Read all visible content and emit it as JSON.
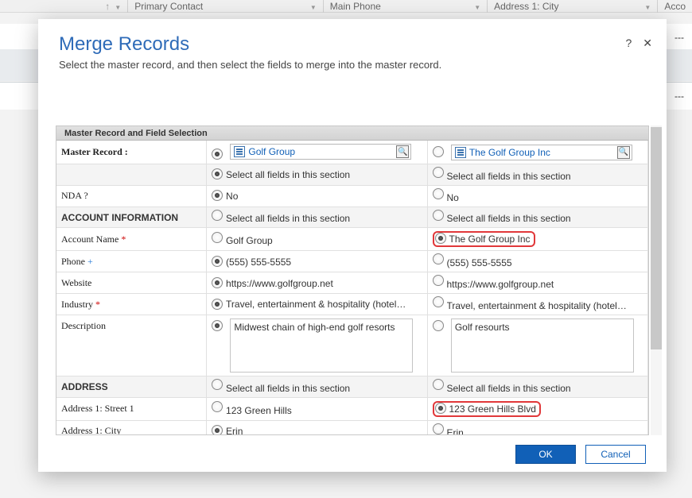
{
  "bg": {
    "cols": [
      "Primary Contact",
      "Main Phone",
      "Address 1: City",
      "Acco"
    ],
    "ellips": "---"
  },
  "dialog": {
    "title": "Merge Records",
    "subtitle": "Select the master record, and then select the fields to merge into the master record.",
    "help": "?",
    "close": "✕",
    "section_bar": "Master Record and Field Selection",
    "master_label": "Master Record :",
    "record1": "Golf Group",
    "record2": "The Golf Group Inc",
    "select_all": "Select all fields in this section",
    "rows": {
      "nda_label": "NDA ?",
      "nda_v1": "No",
      "nda_v2": "No",
      "acct_info": "ACCOUNT INFORMATION",
      "acct_name_label": "Account Name",
      "acct_name_v1": "Golf Group",
      "acct_name_v2": "The Golf Group Inc",
      "phone_label": "Phone",
      "phone_v1": "(555) 555-5555",
      "phone_v2": "(555) 555-5555",
      "website_label": "Website",
      "website_v1": "https://www.golfgroup.net",
      "website_v2": "https://www.golfgroup.net",
      "industry_label": "Industry",
      "industry_v1": "Travel, entertainment & hospitality (hotels, casinos, …",
      "industry_v2": "Travel, entertainment & hospitality (hotels, casinos, …",
      "desc_label": "Description",
      "desc_v1": "Midwest chain of high-end golf resorts",
      "desc_v2": "Golf resourts",
      "addr_section": "ADDRESS",
      "street_label": "Address 1: Street 1",
      "street_v1": "123 Green Hills",
      "street_v2": "123 Green Hills Blvd",
      "city_label": "Address 1: City",
      "city_v1": "Erin",
      "city_v2": "Erin"
    },
    "ok": "OK",
    "cancel": "Cancel"
  }
}
